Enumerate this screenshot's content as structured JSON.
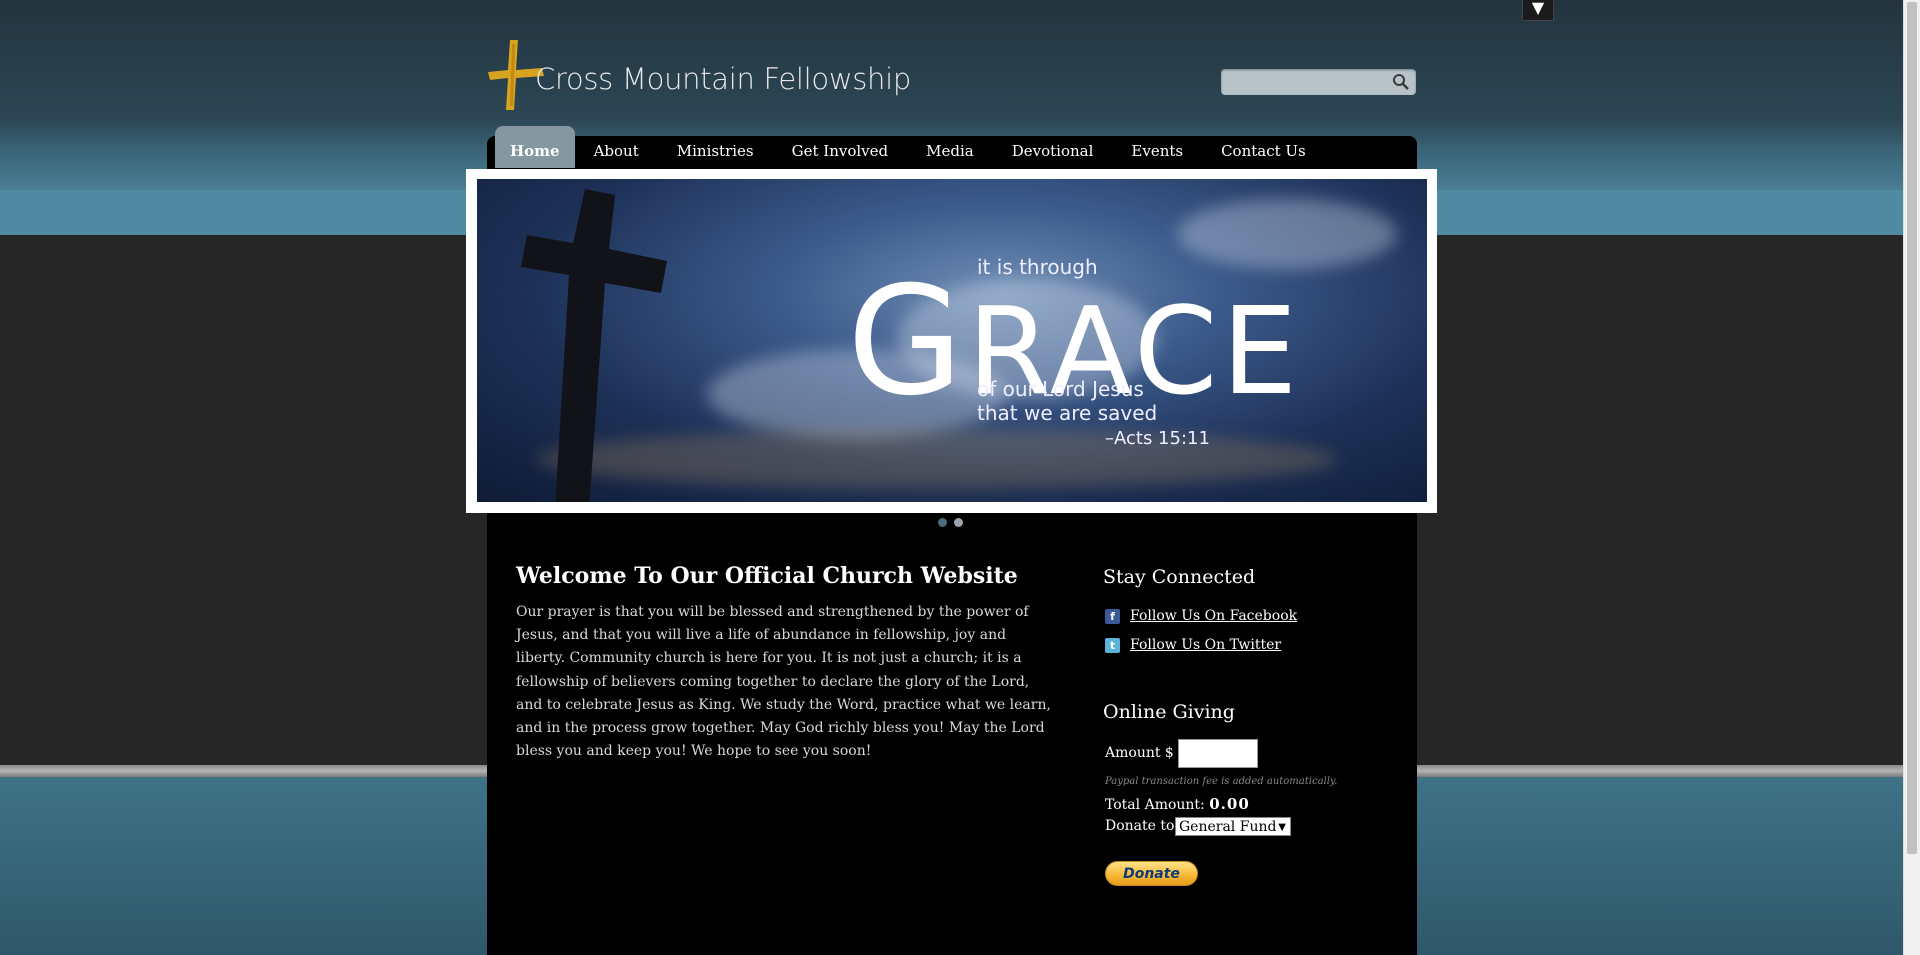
{
  "header": {
    "site_title": "Cross Mountain Fellowship",
    "search": {
      "placeholder": ""
    }
  },
  "top_toggle": "▼",
  "nav": {
    "items": [
      {
        "label": "Home",
        "active": true
      },
      {
        "label": "About"
      },
      {
        "label": "Ministries"
      },
      {
        "label": "Get Involved"
      },
      {
        "label": "Media"
      },
      {
        "label": "Devotional"
      },
      {
        "label": "Events"
      },
      {
        "label": "Contact Us"
      }
    ]
  },
  "banner": {
    "line_top": "it is through",
    "headline_first": "G",
    "headline_rest": "RACE",
    "line_1": "of our Lord Jesus",
    "line_2": "that we are saved",
    "reference": "–Acts 15:11",
    "slides": 2,
    "active_slide": 1
  },
  "main": {
    "title": "Welcome To Our Official Church Website",
    "body": "Our prayer is that you will be blessed and strengthened by the power of Jesus, and that you will live a life of abundance in fellowship, joy and liberty. Community church is here for you. It is not just a church; it is a fellowship of believers coming together to declare the glory of the Lord, and to celebrate Jesus as King. We study the Word, practice what we learn, and in the process grow together. May God richly bless you! May the Lord bless you and keep you! We hope to see you soon!"
  },
  "sidebar": {
    "stay_connected": {
      "title": "Stay Connected",
      "facebook": "Follow Us On Facebook",
      "twitter": "Follow Us On Twitter"
    },
    "giving": {
      "title": "Online Giving",
      "amount_label": "Amount $",
      "amount_value": "",
      "fee_note": "Paypal transaction fee is added automatically.",
      "total_label": "Total Amount:",
      "total_value": "0.00",
      "donate_to_label": "Donate to",
      "fund_selected": "General Fund",
      "donate_button": "Donate"
    }
  },
  "colors": {
    "accent_gold": "#e0a91f",
    "nav_active": "#8496a0",
    "facebook": "#3b5998",
    "twitter": "#5ab4d9"
  }
}
